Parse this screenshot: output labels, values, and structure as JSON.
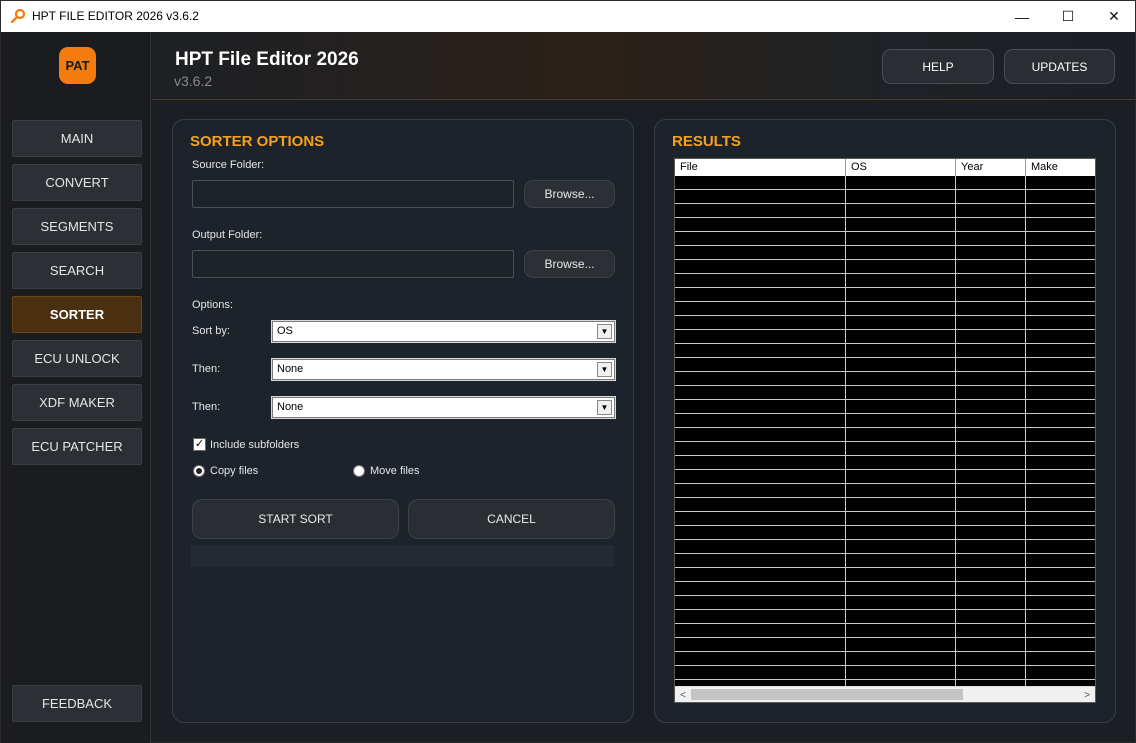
{
  "window": {
    "title": "HPT FILE EDITOR 2026 v3.6.2",
    "minimize": "—",
    "maximize": "☐",
    "close": "✕"
  },
  "sidebar": {
    "logo": "PAT",
    "items": [
      {
        "label": "MAIN"
      },
      {
        "label": "CONVERT"
      },
      {
        "label": "SEGMENTS"
      },
      {
        "label": "SEARCH"
      },
      {
        "label": "SORTER"
      },
      {
        "label": "ECU UNLOCK"
      },
      {
        "label": "XDF MAKER"
      },
      {
        "label": "ECU PATCHER"
      }
    ],
    "active_item": "SORTER",
    "feedback": "FEEDBACK"
  },
  "header": {
    "title": "HPT File Editor 2026",
    "version": "v3.6.2",
    "help": "HELP",
    "updates": "UPDATES"
  },
  "sorter": {
    "title": "SORTER OPTIONS",
    "source_label": "Source Folder:",
    "source_value": "",
    "output_label": "Output Folder:",
    "output_value": "",
    "browse": "Browse...",
    "options_label": "Options:",
    "sort_by_label": "Sort by:",
    "sort_by_value": "OS",
    "then_label": "Then:",
    "then1_value": "None",
    "then2_value": "None",
    "include_subfolders": "Include subfolders",
    "include_subfolders_checked": true,
    "copy_files": "Copy files",
    "move_files": "Move files",
    "selected_mode": "Copy files",
    "start": "START SORT",
    "cancel": "CANCEL"
  },
  "results": {
    "title": "RESULTS",
    "columns": [
      "File",
      "OS",
      "Year",
      "Make"
    ],
    "rows": []
  },
  "colors": {
    "accent": "#f5a020",
    "logo": "#f47b0e",
    "active_nav": "#4a3011"
  }
}
